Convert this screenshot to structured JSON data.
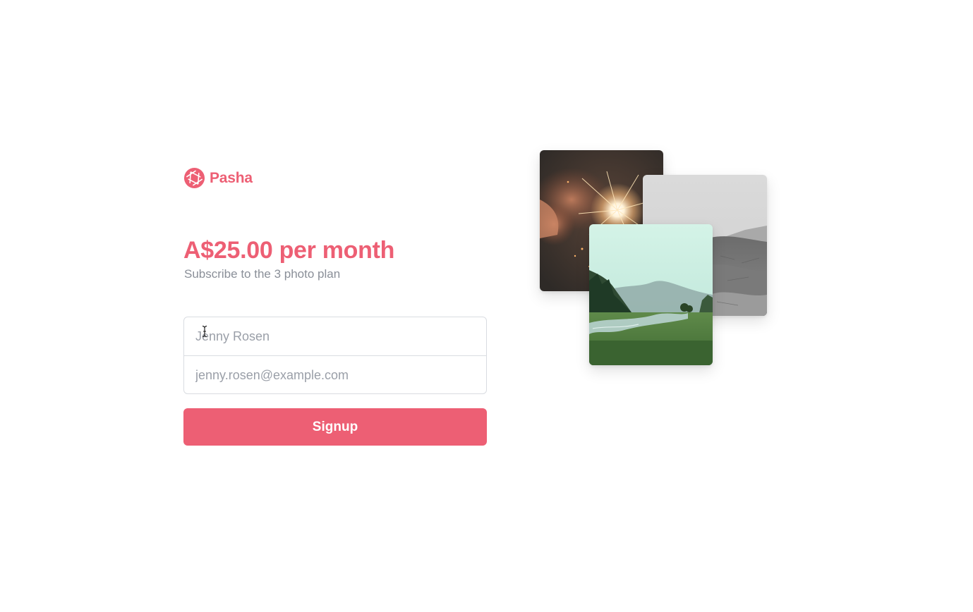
{
  "brand": {
    "name": "Pasha",
    "logo_icon": "camera-aperture-icon",
    "accent_color": "#ed5f74"
  },
  "plan": {
    "price": "A$25.00 per month",
    "description": "Subscribe to the 3 photo plan"
  },
  "form": {
    "name_placeholder": "Jenny Rosen",
    "name_value": "",
    "email_placeholder": "jenny.rosen@example.com",
    "email_value": "",
    "submit_label": "Signup",
    "button_color": "#ed5f74"
  },
  "photos": [
    {
      "name": "sparkler-photo"
    },
    {
      "name": "mountain-photo"
    },
    {
      "name": "valley-photo"
    }
  ]
}
